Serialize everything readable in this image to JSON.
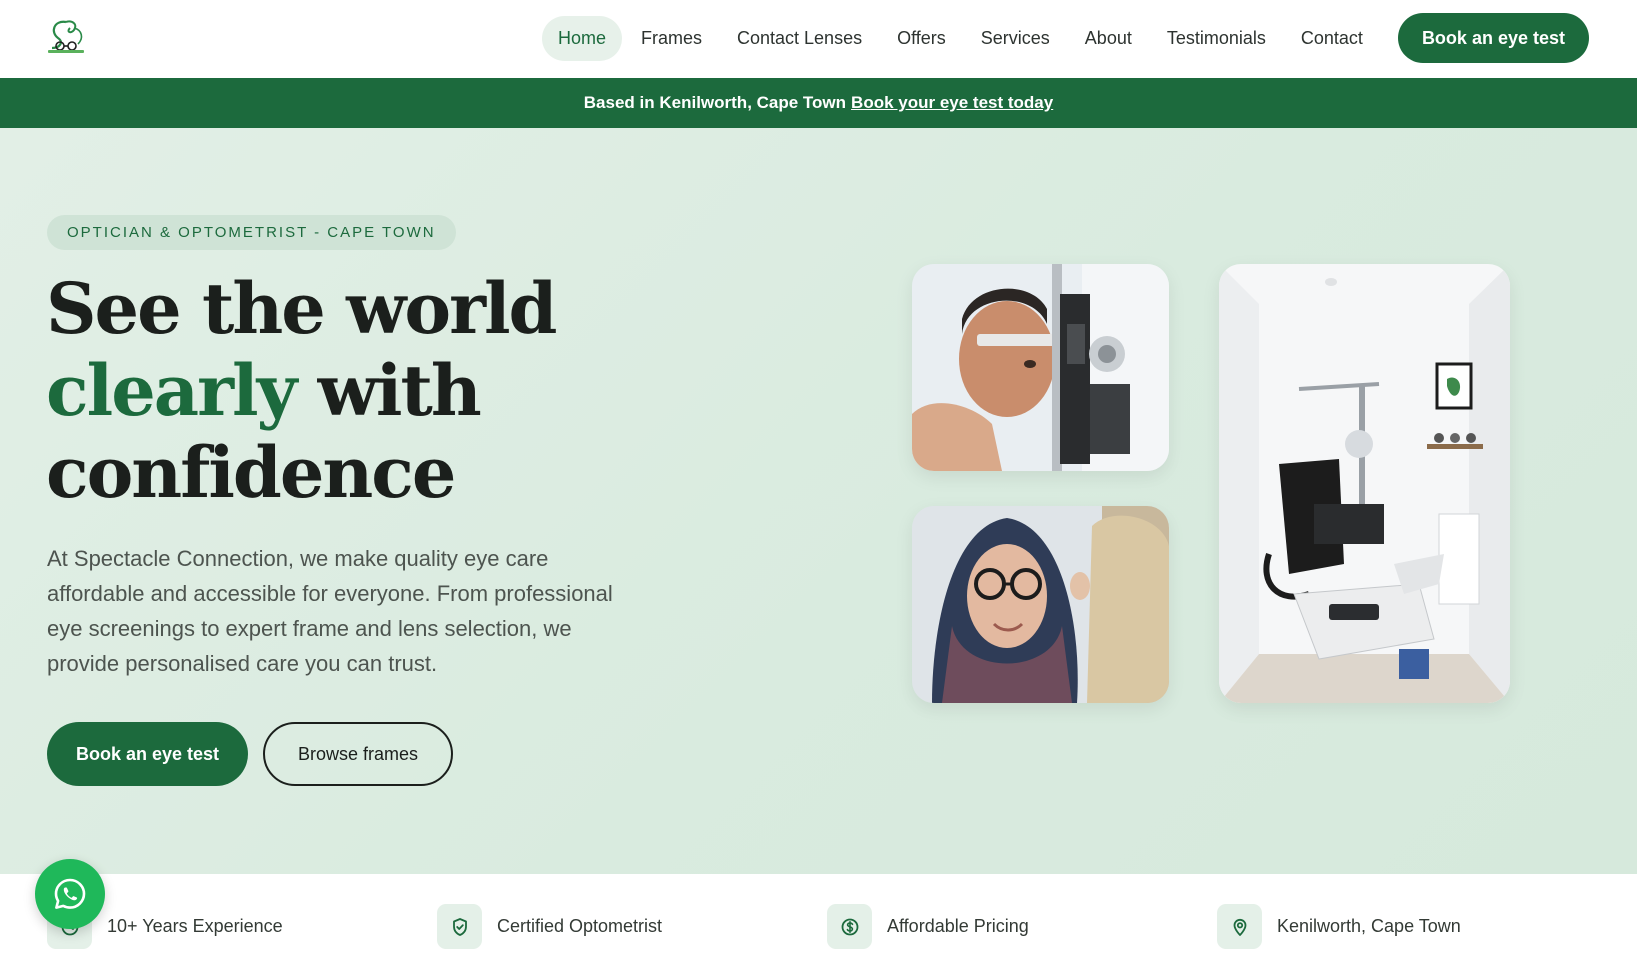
{
  "header": {
    "nav": [
      {
        "label": "Home",
        "active": true
      },
      {
        "label": "Frames"
      },
      {
        "label": "Contact Lenses"
      },
      {
        "label": "Offers"
      },
      {
        "label": "Services"
      },
      {
        "label": "About"
      },
      {
        "label": "Testimonials"
      },
      {
        "label": "Contact"
      }
    ],
    "cta_label": "Book an eye test"
  },
  "announcement": {
    "text": "Based in Kenilworth, Cape Town",
    "link_label": "Book your eye test today"
  },
  "hero": {
    "eyebrow": "OPTICIAN & OPTOMETRIST - CAPE TOWN",
    "headline": {
      "line1": "See the world",
      "accent": "clearly",
      "line2_rest": " with",
      "line3": "confidence"
    },
    "lead": "At Spectacle Connection, we make quality eye care affordable and accessible for everyone. From professional eye screenings to expert frame and lens selection, we provide personalised care you can trust.",
    "primary_button": "Book an eye test",
    "secondary_button": "Browse frames"
  },
  "features": [
    {
      "label": "10+ Years Experience",
      "icon": "clock-icon"
    },
    {
      "label": "Certified Optometrist",
      "icon": "shield-check-icon"
    },
    {
      "label": "Affordable Pricing",
      "icon": "dollar-icon"
    },
    {
      "label": "Kenilworth, Cape Town",
      "icon": "map-pin-icon"
    }
  ],
  "colors": {
    "brand_green": "#1c6a3d",
    "hero_bg": "#dcece2",
    "whatsapp_green": "#1fb85a"
  }
}
